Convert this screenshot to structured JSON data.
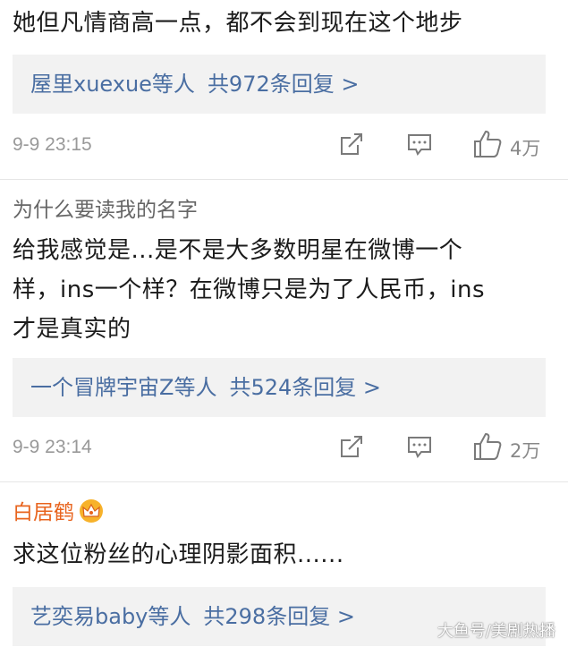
{
  "comments": [
    {
      "username": "",
      "text": "她但凡情商高一点，都不会到现在这个地步",
      "reply_users": "屋里xuexue等人",
      "reply_count": "共972条回复 >",
      "timestamp": "9-9 23:15",
      "like_count": "4万"
    },
    {
      "username": "为什么要读我的名字",
      "text_lines": [
        "给我感觉是...是不是大多数明星在微博一个",
        "样，ins一个样？在微博只是为了人民币，ins",
        "才是真实的"
      ],
      "reply_users": "一个冒牌宇宙Z等人",
      "reply_count": "共524条回复 >",
      "timestamp": "9-9 23:14",
      "like_count": "2万"
    },
    {
      "username": "白居鹤",
      "username_color": "#e8641e",
      "badge": "crown-icon",
      "text": "求这位粉丝的心理阴影面积......",
      "reply_users": "艺奕易baby等人",
      "reply_count": "共298条回复 >"
    }
  ],
  "watermark": "大鱼号/美剧热播",
  "colors": {
    "link_blue": "#4a6ea2",
    "reply_bg": "#f2f2f2",
    "meta_gray": "#999999",
    "vip_orange": "#e8641e"
  }
}
